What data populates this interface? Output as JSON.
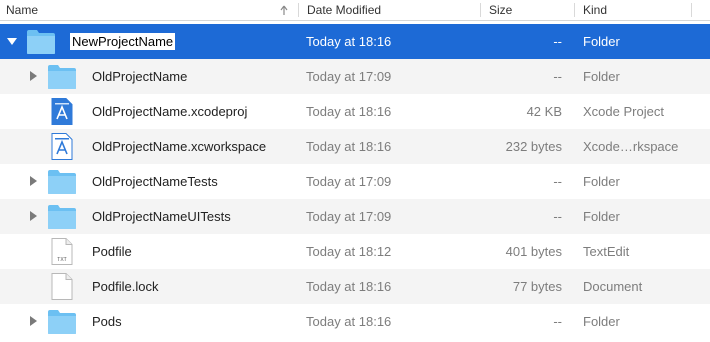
{
  "columns": {
    "name": "Name",
    "date": "Date Modified",
    "size": "Size",
    "kind": "Kind"
  },
  "colors": {
    "selection": "#1d6ad6",
    "folder": "#6cc0f2",
    "alt_row": "#f4f4f4"
  },
  "rows": [
    {
      "name": "NewProjectName",
      "date": "Today at 18:16",
      "size": "--",
      "kind": "Folder",
      "icon": "folder-icon",
      "disclosure": "expanded",
      "selected": true,
      "editing": true
    },
    {
      "name": "OldProjectName",
      "date": "Today at 17:09",
      "size": "--",
      "kind": "Folder",
      "icon": "folder-icon",
      "disclosure": "collapsed"
    },
    {
      "name": "OldProjectName.xcodeproj",
      "date": "Today at 18:16",
      "size": "42 KB",
      "kind": "Xcode Project",
      "icon": "xcodeproj-icon",
      "disclosure": "none"
    },
    {
      "name": "OldProjectName.xcworkspace",
      "date": "Today at 18:16",
      "size": "232 bytes",
      "kind": "Xcode…rkspace",
      "icon": "xcworkspace-icon",
      "disclosure": "none"
    },
    {
      "name": "OldProjectNameTests",
      "date": "Today at 17:09",
      "size": "--",
      "kind": "Folder",
      "icon": "folder-icon",
      "disclosure": "collapsed"
    },
    {
      "name": "OldProjectNameUITests",
      "date": "Today at 17:09",
      "size": "--",
      "kind": "Folder",
      "icon": "folder-icon",
      "disclosure": "collapsed"
    },
    {
      "name": "Podfile",
      "date": "Today at 18:12",
      "size": "401 bytes",
      "kind": "TextEdit",
      "icon": "txt-file-icon",
      "icon_label": "TXT",
      "disclosure": "none"
    },
    {
      "name": "Podfile.lock",
      "date": "Today at 18:16",
      "size": "77 bytes",
      "kind": "Document",
      "icon": "document-icon",
      "disclosure": "none"
    },
    {
      "name": "Pods",
      "date": "Today at 18:16",
      "size": "--",
      "kind": "Folder",
      "icon": "folder-icon",
      "disclosure": "collapsed"
    }
  ]
}
